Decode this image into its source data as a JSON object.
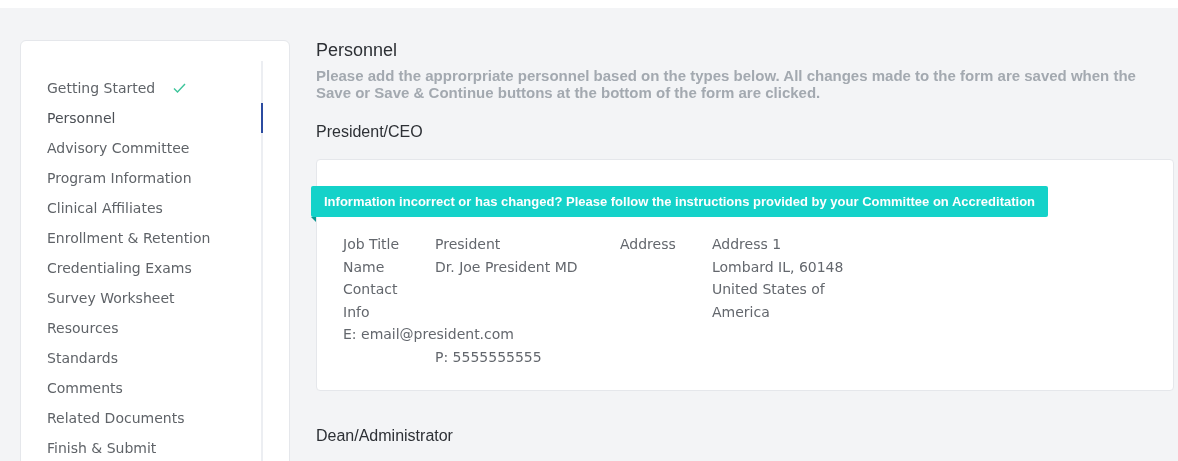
{
  "sidebar": {
    "items": [
      {
        "label": "Getting Started",
        "selected": false,
        "completed": true
      },
      {
        "label": "Personnel",
        "selected": true,
        "completed": false
      },
      {
        "label": "Advisory Committee",
        "selected": false,
        "completed": false
      },
      {
        "label": "Program Information",
        "selected": false,
        "completed": false
      },
      {
        "label": "Clinical Affiliates",
        "selected": false,
        "completed": false
      },
      {
        "label": "Enrollment & Retention",
        "selected": false,
        "completed": false
      },
      {
        "label": "Credentialing Exams",
        "selected": false,
        "completed": false
      },
      {
        "label": "Survey Worksheet",
        "selected": false,
        "completed": false
      },
      {
        "label": "Resources",
        "selected": false,
        "completed": false
      },
      {
        "label": "Standards",
        "selected": false,
        "completed": false
      },
      {
        "label": "Comments",
        "selected": false,
        "completed": false
      },
      {
        "label": "Related Documents",
        "selected": false,
        "completed": false
      },
      {
        "label": "Finish & Submit",
        "selected": false,
        "completed": false
      }
    ]
  },
  "main": {
    "title": "Personnel",
    "description": "Please add the approrpriate personnel based on the types below. All changes made to the form are saved when the Save or Save & Continue buttons at the bottom of the form are clicked.",
    "sections": [
      {
        "heading": "President/CEO",
        "banner": "Information incorrect or has changed? Please follow the instructions provided by your Committee on Accreditation",
        "job_title_label": "Job Title",
        "job_title": "President",
        "name_label": "Name",
        "name": "Dr. Joe President MD",
        "contact_label": "Contact Info",
        "email": "E: email@president.com",
        "phone": "P: 5555555555",
        "address_label": "Address",
        "address_lines": [
          "Address 1",
          "Lombard IL, 60148",
          "United States of America"
        ]
      },
      {
        "heading": "Dean/Administrator"
      }
    ]
  }
}
